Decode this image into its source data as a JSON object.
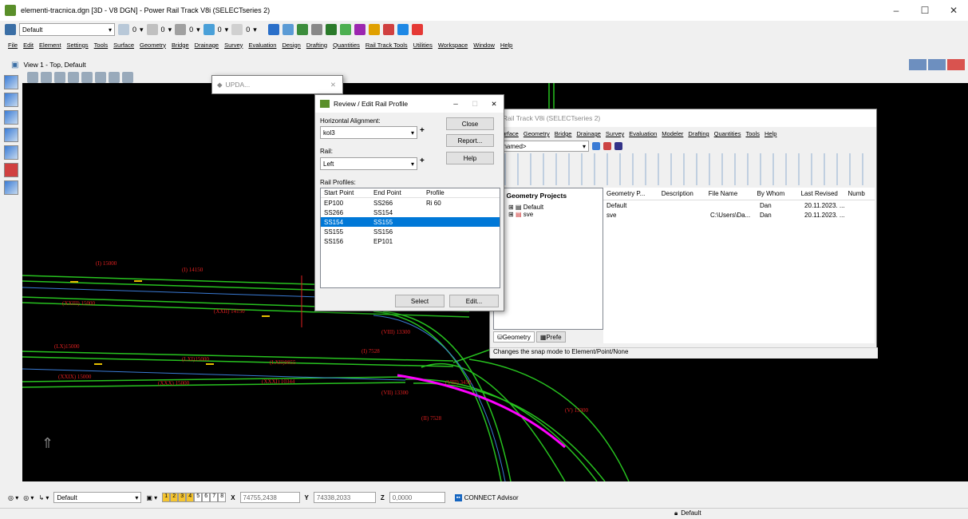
{
  "app": {
    "title": "elementi-tracnica.dgn [3D - V8 DGN] - Power Rail Track V8i (SELECTseries 2)",
    "workflow": "Default"
  },
  "window_controls": {
    "min": "–",
    "max": "☐",
    "close": "✕"
  },
  "menu": [
    "File",
    "Edit",
    "Element",
    "Settings",
    "Tools",
    "Surface",
    "Geometry",
    "Bridge",
    "Drainage",
    "Survey",
    "Evaluation",
    "Design",
    "Drafting",
    "Quantities",
    "Rail Track Tools",
    "Utilities",
    "Workspace",
    "Window",
    "Help"
  ],
  "toolbar": {
    "level_values": [
      "0",
      "0",
      "0",
      "0",
      "0"
    ]
  },
  "view": {
    "title": "View 1 - Top, Default"
  },
  "update_dialog": {
    "title": "UPDA..."
  },
  "review_dialog": {
    "title": "Review / Edit Rail Profile",
    "horizontal_alignment_label": "Horizontal Alignment:",
    "horizontal_alignment_value": "kol3",
    "rail_label": "Rail:",
    "rail_value": "Left",
    "profiles_label": "Rail Profiles:",
    "columns": [
      "Start Point",
      "End Point",
      "Profile"
    ],
    "rows": [
      [
        "EP100",
        "SS266",
        "Ri 60"
      ],
      [
        "SS266",
        "SS154",
        ""
      ],
      [
        "SS154",
        "SS155",
        ""
      ],
      [
        "SS155",
        "SS156",
        ""
      ],
      [
        "SS156",
        "EP101",
        ""
      ]
    ],
    "selected_row": 2,
    "buttons": {
      "close": "Close",
      "report": "Report...",
      "help": "Help",
      "select": "Select",
      "edit": "Edit..."
    },
    "plus": "+"
  },
  "geometry_window": {
    "title": "er Rail Track V8i (SELECTseries 2)",
    "menu": [
      "Surface",
      "Geometry",
      "Bridge",
      "Drainage",
      "Survey",
      "Evaluation",
      "Modeler",
      "Drafting",
      "Quantities",
      "Tools",
      "Help"
    ],
    "combo": "Jnnamed>",
    "tree_root": "Geometry Projects",
    "tree_items": [
      "Default",
      "sve"
    ],
    "columns": [
      "Geometry P...",
      "Description",
      "File Name",
      "By Whom",
      "Last Revised",
      "Numb"
    ],
    "rows": [
      [
        "Default",
        "",
        "",
        "Dan",
        "20.11.2023. ..."
      ],
      [
        "sve",
        "",
        "C:\\Users\\Da...",
        "Dan",
        "20.11.2023. ..."
      ]
    ],
    "tabs": [
      "Geometry",
      "Prefe"
    ],
    "status": "Changes the snap mode to Element/Point/None"
  },
  "cad_labels": [
    "(I) 15000",
    "(I) 14150",
    "(XXIII) 15000",
    "(XXII) 14150",
    "(LX)15000",
    "(LXI)15000",
    "(LXII)9855",
    "(XXIX) 15000",
    "(XXX) 15000",
    "(XXXI) 10344",
    "(VIII) 13300",
    "(I) 7528",
    "(VII) 13300",
    "(V) 13300",
    "(II) 7528",
    "(VIII) 3458"
  ],
  "status": {
    "level": "Default",
    "views": [
      "1",
      "2",
      "3",
      "4",
      "5",
      "6",
      "7",
      "8"
    ],
    "x_label": "X",
    "x": "74755,2438",
    "y_label": "Y",
    "y": "74338,2033",
    "z_label": "Z",
    "z": "0,0000",
    "advisor": "CONNECT Advisor",
    "default2": "Default"
  },
  "colors": {
    "selection": "#0078d7",
    "rail_green": "#27c21f",
    "rail_magenta": "#ff00ff",
    "cad_red": "#e02020"
  }
}
